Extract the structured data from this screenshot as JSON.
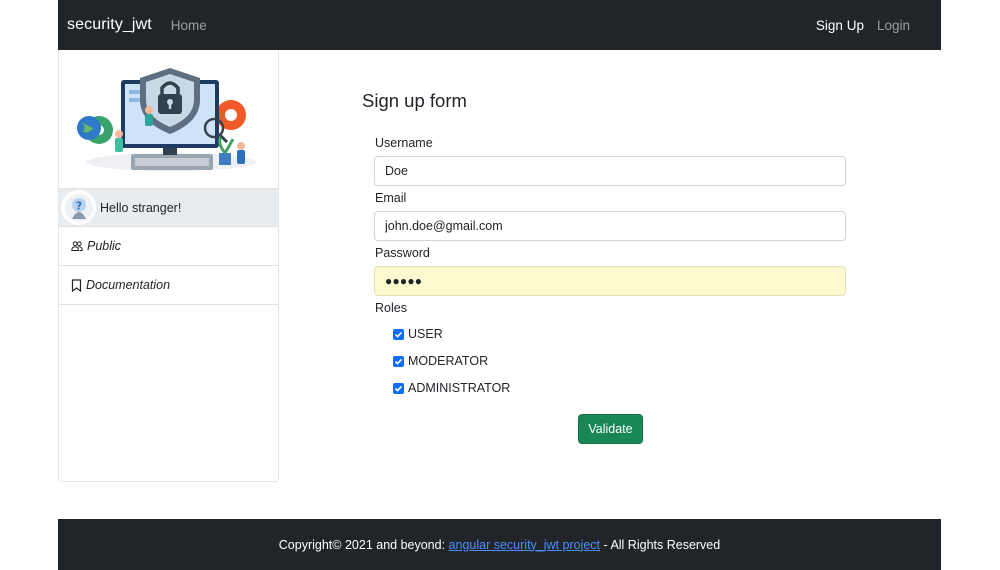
{
  "navbar": {
    "brand": "security_jwt",
    "home": "Home",
    "signup": "Sign Up",
    "login": "Login"
  },
  "sidebar": {
    "illustration_icon": "security-lock-illustration",
    "avatar_icon": "question-avatar-icon",
    "greeting": "Hello stranger!",
    "items": [
      {
        "label": "Public",
        "icon": "people-icon"
      },
      {
        "label": "Documentation",
        "icon": "bookmark-icon"
      }
    ]
  },
  "form": {
    "title": "Sign up form",
    "username_label": "Username",
    "username_value": "Doe",
    "email_label": "Email",
    "email_value": "john.doe@gmail.com",
    "password_label": "Password",
    "password_masked": "●●●●●",
    "roles_label": "Roles",
    "roles": [
      {
        "label": "USER",
        "checked": true
      },
      {
        "label": "MODERATOR",
        "checked": true
      },
      {
        "label": "ADMINISTRATOR",
        "checked": true
      }
    ],
    "submit": "Validate"
  },
  "footer": {
    "prefix": "Copyright© 2021 and beyond:",
    "link": "angular security_jwt project",
    "suffix": "- All Rights Reserved"
  },
  "colors": {
    "navbar_bg": "#212529",
    "accent": "#0d6efd",
    "success": "#198754",
    "autofill": "#fdfad0"
  }
}
